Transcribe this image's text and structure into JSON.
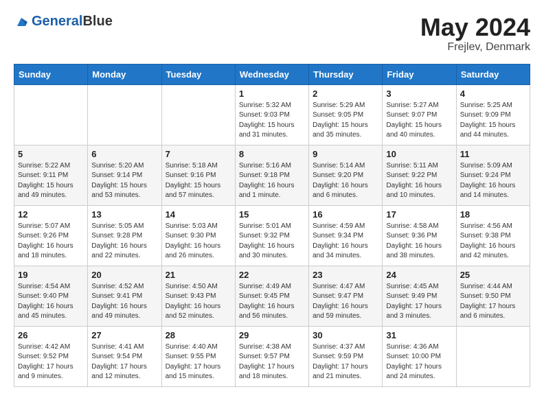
{
  "header": {
    "logo_general": "General",
    "logo_blue": "Blue",
    "month_year": "May 2024",
    "location": "Frejlev, Denmark"
  },
  "days_of_week": [
    "Sunday",
    "Monday",
    "Tuesday",
    "Wednesday",
    "Thursday",
    "Friday",
    "Saturday"
  ],
  "weeks": [
    [
      {
        "day": "",
        "sunrise": "",
        "sunset": "",
        "daylight": ""
      },
      {
        "day": "",
        "sunrise": "",
        "sunset": "",
        "daylight": ""
      },
      {
        "day": "",
        "sunrise": "",
        "sunset": "",
        "daylight": ""
      },
      {
        "day": "1",
        "sunrise": "Sunrise: 5:32 AM",
        "sunset": "Sunset: 9:03 PM",
        "daylight": "Daylight: 15 hours and 31 minutes."
      },
      {
        "day": "2",
        "sunrise": "Sunrise: 5:29 AM",
        "sunset": "Sunset: 9:05 PM",
        "daylight": "Daylight: 15 hours and 35 minutes."
      },
      {
        "day": "3",
        "sunrise": "Sunrise: 5:27 AM",
        "sunset": "Sunset: 9:07 PM",
        "daylight": "Daylight: 15 hours and 40 minutes."
      },
      {
        "day": "4",
        "sunrise": "Sunrise: 5:25 AM",
        "sunset": "Sunset: 9:09 PM",
        "daylight": "Daylight: 15 hours and 44 minutes."
      }
    ],
    [
      {
        "day": "5",
        "sunrise": "Sunrise: 5:22 AM",
        "sunset": "Sunset: 9:11 PM",
        "daylight": "Daylight: 15 hours and 49 minutes."
      },
      {
        "day": "6",
        "sunrise": "Sunrise: 5:20 AM",
        "sunset": "Sunset: 9:14 PM",
        "daylight": "Daylight: 15 hours and 53 minutes."
      },
      {
        "day": "7",
        "sunrise": "Sunrise: 5:18 AM",
        "sunset": "Sunset: 9:16 PM",
        "daylight": "Daylight: 15 hours and 57 minutes."
      },
      {
        "day": "8",
        "sunrise": "Sunrise: 5:16 AM",
        "sunset": "Sunset: 9:18 PM",
        "daylight": "Daylight: 16 hours and 1 minute."
      },
      {
        "day": "9",
        "sunrise": "Sunrise: 5:14 AM",
        "sunset": "Sunset: 9:20 PM",
        "daylight": "Daylight: 16 hours and 6 minutes."
      },
      {
        "day": "10",
        "sunrise": "Sunrise: 5:11 AM",
        "sunset": "Sunset: 9:22 PM",
        "daylight": "Daylight: 16 hours and 10 minutes."
      },
      {
        "day": "11",
        "sunrise": "Sunrise: 5:09 AM",
        "sunset": "Sunset: 9:24 PM",
        "daylight": "Daylight: 16 hours and 14 minutes."
      }
    ],
    [
      {
        "day": "12",
        "sunrise": "Sunrise: 5:07 AM",
        "sunset": "Sunset: 9:26 PM",
        "daylight": "Daylight: 16 hours and 18 minutes."
      },
      {
        "day": "13",
        "sunrise": "Sunrise: 5:05 AM",
        "sunset": "Sunset: 9:28 PM",
        "daylight": "Daylight: 16 hours and 22 minutes."
      },
      {
        "day": "14",
        "sunrise": "Sunrise: 5:03 AM",
        "sunset": "Sunset: 9:30 PM",
        "daylight": "Daylight: 16 hours and 26 minutes."
      },
      {
        "day": "15",
        "sunrise": "Sunrise: 5:01 AM",
        "sunset": "Sunset: 9:32 PM",
        "daylight": "Daylight: 16 hours and 30 minutes."
      },
      {
        "day": "16",
        "sunrise": "Sunrise: 4:59 AM",
        "sunset": "Sunset: 9:34 PM",
        "daylight": "Daylight: 16 hours and 34 minutes."
      },
      {
        "day": "17",
        "sunrise": "Sunrise: 4:58 AM",
        "sunset": "Sunset: 9:36 PM",
        "daylight": "Daylight: 16 hours and 38 minutes."
      },
      {
        "day": "18",
        "sunrise": "Sunrise: 4:56 AM",
        "sunset": "Sunset: 9:38 PM",
        "daylight": "Daylight: 16 hours and 42 minutes."
      }
    ],
    [
      {
        "day": "19",
        "sunrise": "Sunrise: 4:54 AM",
        "sunset": "Sunset: 9:40 PM",
        "daylight": "Daylight: 16 hours and 45 minutes."
      },
      {
        "day": "20",
        "sunrise": "Sunrise: 4:52 AM",
        "sunset": "Sunset: 9:41 PM",
        "daylight": "Daylight: 16 hours and 49 minutes."
      },
      {
        "day": "21",
        "sunrise": "Sunrise: 4:50 AM",
        "sunset": "Sunset: 9:43 PM",
        "daylight": "Daylight: 16 hours and 52 minutes."
      },
      {
        "day": "22",
        "sunrise": "Sunrise: 4:49 AM",
        "sunset": "Sunset: 9:45 PM",
        "daylight": "Daylight: 16 hours and 56 minutes."
      },
      {
        "day": "23",
        "sunrise": "Sunrise: 4:47 AM",
        "sunset": "Sunset: 9:47 PM",
        "daylight": "Daylight: 16 hours and 59 minutes."
      },
      {
        "day": "24",
        "sunrise": "Sunrise: 4:45 AM",
        "sunset": "Sunset: 9:49 PM",
        "daylight": "Daylight: 17 hours and 3 minutes."
      },
      {
        "day": "25",
        "sunrise": "Sunrise: 4:44 AM",
        "sunset": "Sunset: 9:50 PM",
        "daylight": "Daylight: 17 hours and 6 minutes."
      }
    ],
    [
      {
        "day": "26",
        "sunrise": "Sunrise: 4:42 AM",
        "sunset": "Sunset: 9:52 PM",
        "daylight": "Daylight: 17 hours and 9 minutes."
      },
      {
        "day": "27",
        "sunrise": "Sunrise: 4:41 AM",
        "sunset": "Sunset: 9:54 PM",
        "daylight": "Daylight: 17 hours and 12 minutes."
      },
      {
        "day": "28",
        "sunrise": "Sunrise: 4:40 AM",
        "sunset": "Sunset: 9:55 PM",
        "daylight": "Daylight: 17 hours and 15 minutes."
      },
      {
        "day": "29",
        "sunrise": "Sunrise: 4:38 AM",
        "sunset": "Sunset: 9:57 PM",
        "daylight": "Daylight: 17 hours and 18 minutes."
      },
      {
        "day": "30",
        "sunrise": "Sunrise: 4:37 AM",
        "sunset": "Sunset: 9:59 PM",
        "daylight": "Daylight: 17 hours and 21 minutes."
      },
      {
        "day": "31",
        "sunrise": "Sunrise: 4:36 AM",
        "sunset": "Sunset: 10:00 PM",
        "daylight": "Daylight: 17 hours and 24 minutes."
      },
      {
        "day": "",
        "sunrise": "",
        "sunset": "",
        "daylight": ""
      }
    ]
  ]
}
